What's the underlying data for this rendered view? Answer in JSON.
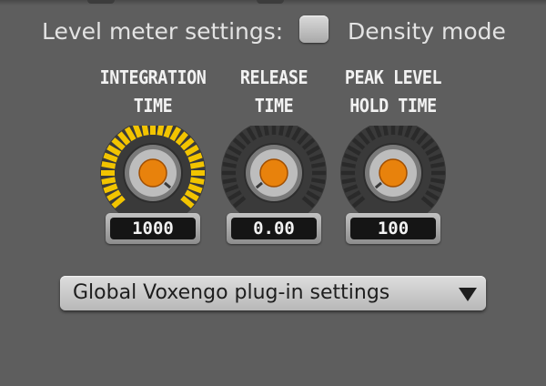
{
  "settings": {
    "level_meter_label": "Level meter settings:",
    "density_mode_label": "Density mode",
    "density_mode_checked": false
  },
  "knobs": [
    {
      "title_line1": "INTEGRATION",
      "title_line2": "TIME",
      "value": "1000",
      "level": 1.0,
      "active": true
    },
    {
      "title_line1": "RELEASE",
      "title_line2": "TIME",
      "value": "0.00",
      "level": 0.0,
      "active": false
    },
    {
      "title_line1": "PEAK LEVEL",
      "title_line2": "HOLD TIME",
      "value": "100",
      "level": 0.0,
      "active": false
    }
  ],
  "dropdown": {
    "label": "Global Voxengo plug-in settings",
    "icon": "triangle-down-icon"
  },
  "colors": {
    "background": "#5e5e5e",
    "knob_cap": "#e8820c",
    "active_ring": "#f2c400",
    "inactive_ring": "#2a2a2a",
    "text": "#e3e3e3"
  }
}
